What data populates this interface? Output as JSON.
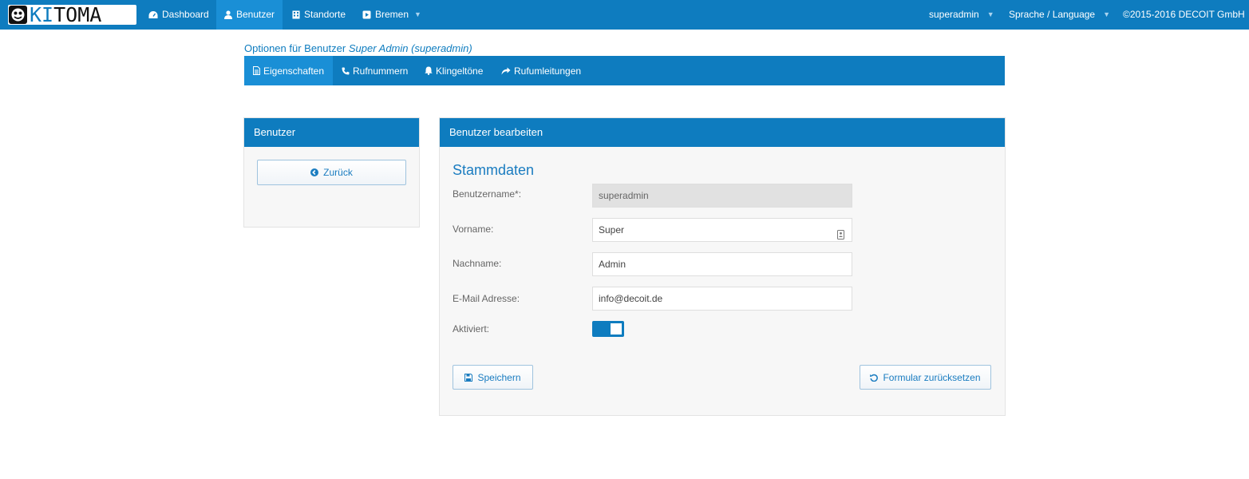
{
  "app": {
    "logo_text_a": "KI",
    "logo_text_b": "TOMA",
    "brand_color": "#0e7cbf"
  },
  "navbar": {
    "items": [
      {
        "label": "Dashboard",
        "icon": "dashboard-icon"
      },
      {
        "label": "Benutzer",
        "icon": "user-icon",
        "active": true
      },
      {
        "label": "Standorte",
        "icon": "building-icon"
      },
      {
        "label": "Bremen",
        "icon": "location-square-icon",
        "dropdown": true
      }
    ],
    "right": {
      "user": "superadmin",
      "language": "Sprache / Language",
      "copyright": "©2015-2016 DECOIT GmbH"
    }
  },
  "page": {
    "title_prefix": "Optionen für Benutzer",
    "title_user": "Super Admin (superadmin)"
  },
  "tabs": [
    {
      "label": "Eigenschaften",
      "icon": "document-icon",
      "active": true
    },
    {
      "label": "Rufnummern",
      "icon": "phone-icon"
    },
    {
      "label": "Klingeltöne",
      "icon": "bell-icon"
    },
    {
      "label": "Rufumleitungen",
      "icon": "share-arrow-icon"
    }
  ],
  "left_panel": {
    "title": "Benutzer",
    "back_label": "Zurück"
  },
  "right_panel": {
    "title": "Benutzer bearbeiten",
    "section": "Stammdaten",
    "fields": {
      "username": {
        "label": "Benutzername*:",
        "value": "superadmin"
      },
      "firstname": {
        "label": "Vorname:",
        "value": "Super"
      },
      "lastname": {
        "label": "Nachname:",
        "value": "Admin"
      },
      "email": {
        "label": "E-Mail Adresse:",
        "value": "info@decoit.de"
      },
      "active": {
        "label": "Aktiviert:",
        "value": true
      }
    },
    "save_label": "Speichern",
    "reset_label": "Formular zurücksetzen"
  }
}
